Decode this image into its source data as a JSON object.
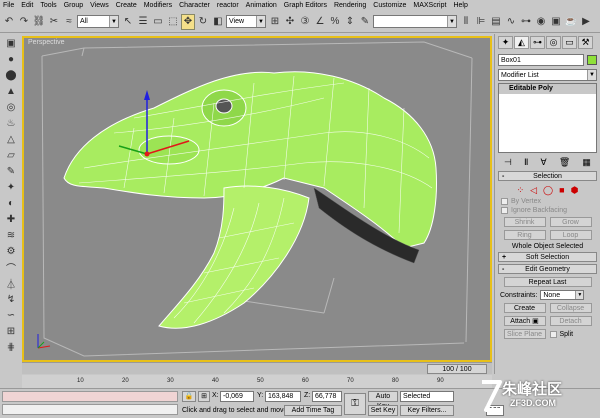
{
  "menubar": [
    "File",
    "Edit",
    "Tools",
    "Group",
    "Views",
    "Create",
    "Modifiers",
    "Character",
    "reactor",
    "Animation",
    "Graph Editors",
    "Rendering",
    "Customize",
    "MAXScript",
    "Help"
  ],
  "toolbar": {
    "selection_filter": "All",
    "ref_coord": "View",
    "named_selection": ""
  },
  "viewport": {
    "label": "Perspective",
    "border_color": "#e8c018",
    "mesh_color": "#a8ec60"
  },
  "command_panel": {
    "object_name": "Box01",
    "object_color": "#8fe03a",
    "modifier_list": "Modifier List",
    "stack_entry": "Editable Poly",
    "selection_rollout": {
      "title": "Selection",
      "sign": "-",
      "by_vertex": "By Vertex",
      "ignore_backfacing": "Ignore Backfacing",
      "shrink": "Shrink",
      "grow": "Grow",
      "ring": "Ring",
      "loop": "Loop",
      "status": "Whole Object Selected"
    },
    "soft_selection": {
      "title": "Soft Selection",
      "sign": "+"
    },
    "edit_geometry": {
      "title": "Edit Geometry",
      "sign": "-",
      "repeat_last": "Repeat Last",
      "constraints_label": "Constraints:",
      "constraints_value": "None",
      "create": "Create",
      "collapse": "Collapse",
      "attach": "Attach",
      "detach": "Detach",
      "slice_plane": "Slice Plane",
      "split": "Split"
    }
  },
  "time_slider": {
    "label": "100 / 100",
    "position": 1.0
  },
  "trackbar": {
    "ticks": [
      "10",
      "20",
      "30",
      "40",
      "50",
      "60",
      "70",
      "80",
      "90"
    ]
  },
  "status": {
    "x_label": "X:",
    "x_value": "-0,069",
    "y_label": "Y:",
    "y_value": "163,848",
    "z_label": "Z:",
    "z_value": "66,778",
    "prompt": "Click and drag to select and move",
    "add_time_tag": "Add Time Tag",
    "auto_key": "Auto Key",
    "set_key": "Set Key",
    "selected": "Selected",
    "key_filters": "Key Filters...",
    "frame": "100"
  },
  "watermark": {
    "text": "朱峰社区",
    "sub": "ZF3D.COM"
  }
}
